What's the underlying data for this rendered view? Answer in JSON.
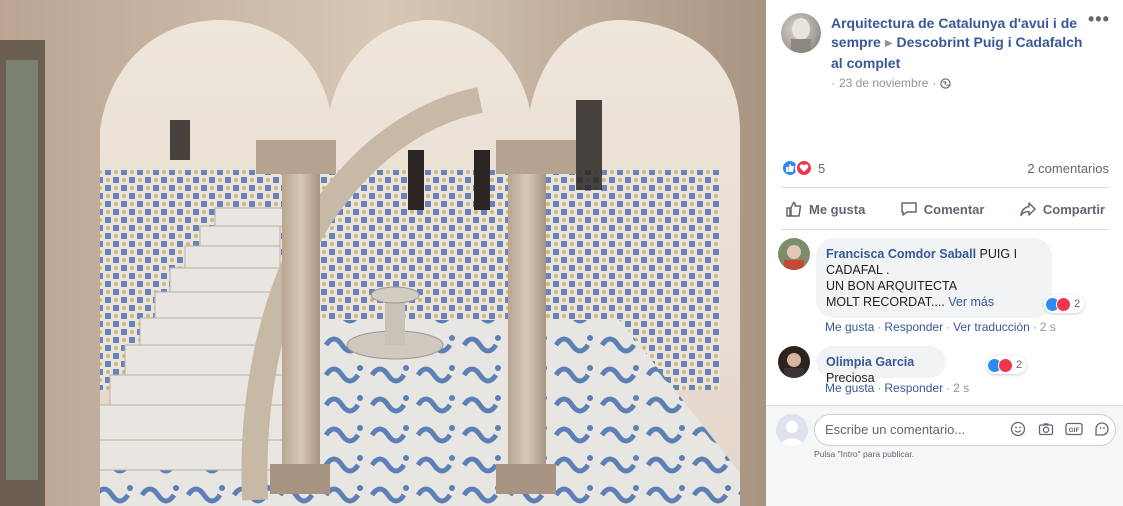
{
  "post": {
    "page_name": "Arquitectura de Catalunya d'avui i de sempre",
    "album_name": "Descobrint Puig i Cadafalch al complet",
    "date": "23 de noviembre",
    "reaction_count": "5",
    "comments_count": "2 comentarios"
  },
  "actions": {
    "like": "Me gusta",
    "comment": "Comentar",
    "share": "Compartir"
  },
  "comments": [
    {
      "author": "Francisca Comdor Saball",
      "line1": "PUIG I",
      "line2": "CADAFAL .",
      "line3": "UN BON ARQUITECTA",
      "line4": "MOLT RECORDAT....",
      "see_more": "Ver más",
      "reactions": "2",
      "like": "Me gusta",
      "reply": "Responder",
      "translate": "Ver traducción",
      "time": "2 s"
    },
    {
      "author": "Olimpia Garcia",
      "text": "Preciosa",
      "reactions": "2",
      "like": "Me gusta",
      "reply": "Responder",
      "time": "2 s"
    }
  ],
  "composer": {
    "placeholder": "Escribe un comentario...",
    "hint": "Pulsa \"Intro\" para publicar."
  },
  "colors": {
    "link": "#385898",
    "like_blue": "#2e8cf0",
    "love_red": "#f0364e",
    "muted": "#90949c"
  }
}
